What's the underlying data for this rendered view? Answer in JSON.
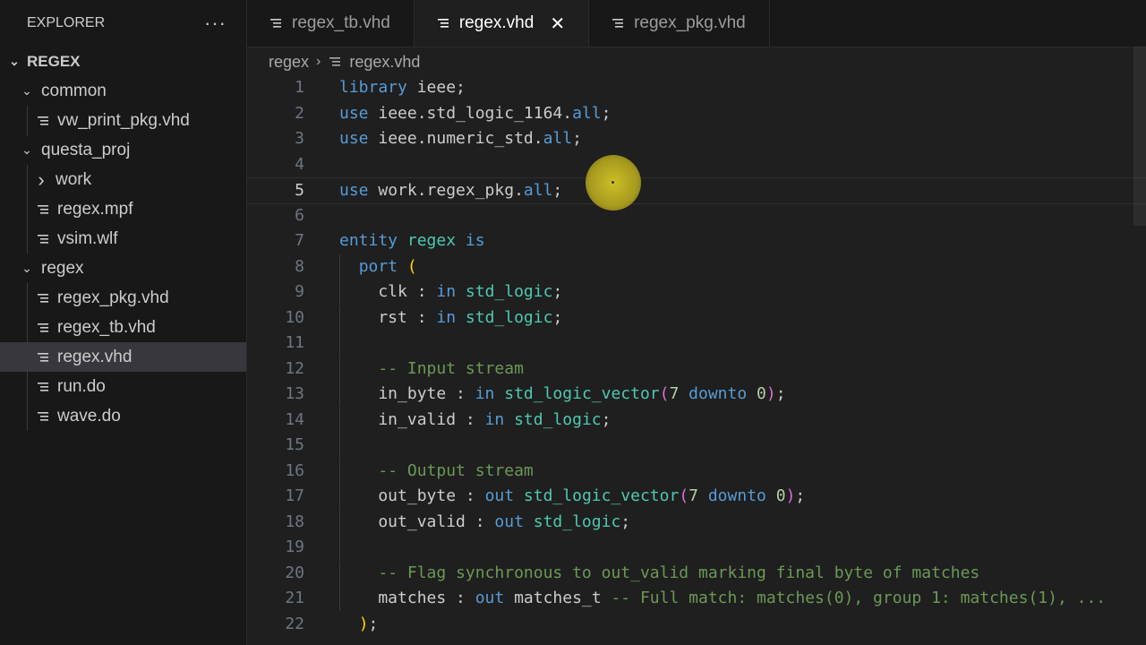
{
  "explorer": {
    "title": "EXPLORER",
    "more_actions": "···",
    "root": "REGEX",
    "items": [
      {
        "label": "common",
        "type": "folder",
        "expanded": true,
        "depth": 1
      },
      {
        "label": "vw_print_pkg.vhd",
        "type": "file",
        "depth": 2
      },
      {
        "label": "questa_proj",
        "type": "folder",
        "expanded": true,
        "depth": 1
      },
      {
        "label": "work",
        "type": "folder",
        "expanded": false,
        "depth": 2
      },
      {
        "label": "regex.mpf",
        "type": "file",
        "depth": 2
      },
      {
        "label": "vsim.wlf",
        "type": "file",
        "depth": 2
      },
      {
        "label": "regex",
        "type": "folder",
        "expanded": true,
        "depth": 1
      },
      {
        "label": "regex_pkg.vhd",
        "type": "file",
        "depth": 2
      },
      {
        "label": "regex_tb.vhd",
        "type": "file",
        "depth": 2
      },
      {
        "label": "regex.vhd",
        "type": "file",
        "depth": 2,
        "selected": true
      },
      {
        "label": "run.do",
        "type": "file",
        "depth": 2
      },
      {
        "label": "wave.do",
        "type": "file",
        "depth": 2
      }
    ]
  },
  "tabs": [
    {
      "label": "regex_tb.vhd",
      "active": false
    },
    {
      "label": "regex.vhd",
      "active": true,
      "close": "✕"
    },
    {
      "label": "regex_pkg.vhd",
      "active": false
    }
  ],
  "breadcrumb": {
    "folder": "regex",
    "separator": "›",
    "file": "regex.vhd"
  },
  "editor": {
    "current_line": 5,
    "lines": [
      {
        "n": "1",
        "tokens": [
          [
            "kw",
            "library"
          ],
          [
            "tx",
            " ieee;"
          ]
        ]
      },
      {
        "n": "2",
        "tokens": [
          [
            "kw",
            "use"
          ],
          [
            "tx",
            " ieee.std_logic_1164."
          ],
          [
            "kw",
            "all"
          ],
          [
            "tx",
            ";"
          ]
        ]
      },
      {
        "n": "3",
        "tokens": [
          [
            "kw",
            "use"
          ],
          [
            "tx",
            " ieee.numeric_std."
          ],
          [
            "kw",
            "all"
          ],
          [
            "tx",
            ";"
          ]
        ]
      },
      {
        "n": "4",
        "tokens": []
      },
      {
        "n": "5",
        "tokens": [
          [
            "kw",
            "use"
          ],
          [
            "tx",
            " work.regex_pkg."
          ],
          [
            "kw",
            "all"
          ],
          [
            "tx",
            ";"
          ]
        ]
      },
      {
        "n": "6",
        "tokens": []
      },
      {
        "n": "7",
        "tokens": [
          [
            "kw",
            "entity"
          ],
          [
            "tx",
            " "
          ],
          [
            "ty",
            "regex"
          ],
          [
            "tx",
            " "
          ],
          [
            "kw",
            "is"
          ]
        ]
      },
      {
        "n": "8",
        "tokens": [
          [
            "tx",
            "  "
          ],
          [
            "kw",
            "port"
          ],
          [
            "tx",
            " "
          ],
          [
            "br1",
            "("
          ]
        ]
      },
      {
        "n": "9",
        "tokens": [
          [
            "tx",
            "    clk : "
          ],
          [
            "kw",
            "in"
          ],
          [
            "tx",
            " "
          ],
          [
            "ty",
            "std_logic"
          ],
          [
            "tx",
            ";"
          ]
        ]
      },
      {
        "n": "10",
        "tokens": [
          [
            "tx",
            "    rst : "
          ],
          [
            "kw",
            "in"
          ],
          [
            "tx",
            " "
          ],
          [
            "ty",
            "std_logic"
          ],
          [
            "tx",
            ";"
          ]
        ]
      },
      {
        "n": "11",
        "tokens": []
      },
      {
        "n": "12",
        "tokens": [
          [
            "tx",
            "    "
          ],
          [
            "cm",
            "-- Input stream"
          ]
        ]
      },
      {
        "n": "13",
        "tokens": [
          [
            "tx",
            "    in_byte : "
          ],
          [
            "kw",
            "in"
          ],
          [
            "tx",
            " "
          ],
          [
            "ty",
            "std_logic_vector"
          ],
          [
            "br2",
            "("
          ],
          [
            "nm",
            "7"
          ],
          [
            "tx",
            " "
          ],
          [
            "kw",
            "downto"
          ],
          [
            "tx",
            " "
          ],
          [
            "nm",
            "0"
          ],
          [
            "br2",
            ")"
          ],
          [
            "tx",
            ";"
          ]
        ]
      },
      {
        "n": "14",
        "tokens": [
          [
            "tx",
            "    in_valid : "
          ],
          [
            "kw",
            "in"
          ],
          [
            "tx",
            " "
          ],
          [
            "ty",
            "std_logic"
          ],
          [
            "tx",
            ";"
          ]
        ]
      },
      {
        "n": "15",
        "tokens": []
      },
      {
        "n": "16",
        "tokens": [
          [
            "tx",
            "    "
          ],
          [
            "cm",
            "-- Output stream"
          ]
        ]
      },
      {
        "n": "17",
        "tokens": [
          [
            "tx",
            "    out_byte : "
          ],
          [
            "kw",
            "out"
          ],
          [
            "tx",
            " "
          ],
          [
            "ty",
            "std_logic_vector"
          ],
          [
            "br2",
            "("
          ],
          [
            "nm",
            "7"
          ],
          [
            "tx",
            " "
          ],
          [
            "kw",
            "downto"
          ],
          [
            "tx",
            " "
          ],
          [
            "nm",
            "0"
          ],
          [
            "br2",
            ")"
          ],
          [
            "tx",
            ";"
          ]
        ]
      },
      {
        "n": "18",
        "tokens": [
          [
            "tx",
            "    out_valid : "
          ],
          [
            "kw",
            "out"
          ],
          [
            "tx",
            " "
          ],
          [
            "ty",
            "std_logic"
          ],
          [
            "tx",
            ";"
          ]
        ]
      },
      {
        "n": "19",
        "tokens": []
      },
      {
        "n": "20",
        "tokens": [
          [
            "tx",
            "    "
          ],
          [
            "cm",
            "-- Flag synchronous to out_valid marking final byte of matches"
          ]
        ]
      },
      {
        "n": "21",
        "tokens": [
          [
            "tx",
            "    matches : "
          ],
          [
            "kw",
            "out"
          ],
          [
            "tx",
            " matches_t "
          ],
          [
            "cm",
            "-- Full match: matches(0), group 1: matches(1), ..."
          ]
        ]
      },
      {
        "n": "22",
        "tokens": [
          [
            "tx",
            "  "
          ],
          [
            "br1",
            ")"
          ],
          [
            "tx",
            ";"
          ]
        ]
      }
    ]
  },
  "colors": {
    "keyword": "#569cd6",
    "type": "#4ec9b0",
    "comment": "#6a9955",
    "number": "#b5cea8",
    "bracket_level1": "#ffd700",
    "bracket_level2": "#da70d6",
    "cursor_highlight": "#d6c828"
  }
}
